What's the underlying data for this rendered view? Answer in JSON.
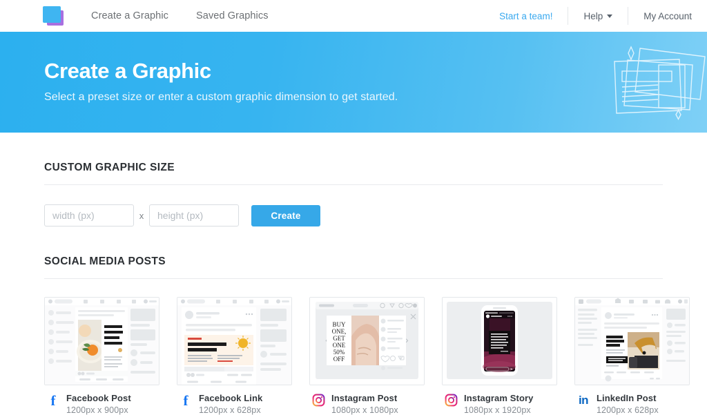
{
  "header": {
    "logo_name": "app-logo",
    "logo_colors": {
      "front": "#3fb5f1",
      "back": "#a86fe0"
    },
    "nav_left": [
      {
        "label": "Create a Graphic",
        "name": "nav-create-a-graphic"
      },
      {
        "label": "Saved Graphics",
        "name": "nav-saved-graphics"
      }
    ],
    "nav_right": {
      "team_link": "Start a team!",
      "help": "Help",
      "account": "My Account"
    }
  },
  "hero": {
    "title": "Create a Graphic",
    "subtitle": "Select a preset size or enter a custom graphic dimension to get started.",
    "bg_from": "#2cb0ef",
    "bg_to": "#7fd0f6"
  },
  "custom_size": {
    "section_title": "CUSTOM GRAPHIC SIZE",
    "width_placeholder": "width (px)",
    "width_value": "",
    "separator": "x",
    "height_placeholder": "height (px)",
    "height_value": "",
    "create_label": "Create",
    "create_color": "#36a8e8"
  },
  "social": {
    "section_title": "SOCIAL MEDIA POSTS",
    "cards": [
      {
        "name": "Facebook Post",
        "dimensions": "1200px x 900px",
        "icon": "facebook-icon",
        "icon_color": "#1877f2",
        "preview_headline": "GREAT JUICE FOR GREAT FRIENDS"
      },
      {
        "name": "Facebook Link",
        "dimensions": "1200px x 628px",
        "icon": "facebook-icon",
        "icon_color": "#1877f2",
        "preview_headline": "Top Ten Benefits of Vitamin D"
      },
      {
        "name": "Instagram Post",
        "dimensions": "1080px x 1080px",
        "icon": "instagram-icon",
        "icon_color": "#d6249f",
        "preview_headline": "BUY ONE, GET ONE 50% OFF"
      },
      {
        "name": "Instagram Story",
        "dimensions": "1080px x 1920px",
        "icon": "instagram-icon",
        "icon_color": "#d6249f",
        "preview_headline": "\"Marketing is the act of telling stories about the things we make—stories that sell & stories that spread.\""
      },
      {
        "name": "LinkedIn Post",
        "dimensions": "1200px x 628px",
        "icon": "linkedin-icon",
        "icon_color": "#0a66c2",
        "preview_headline": "Calling all online editors"
      }
    ]
  }
}
